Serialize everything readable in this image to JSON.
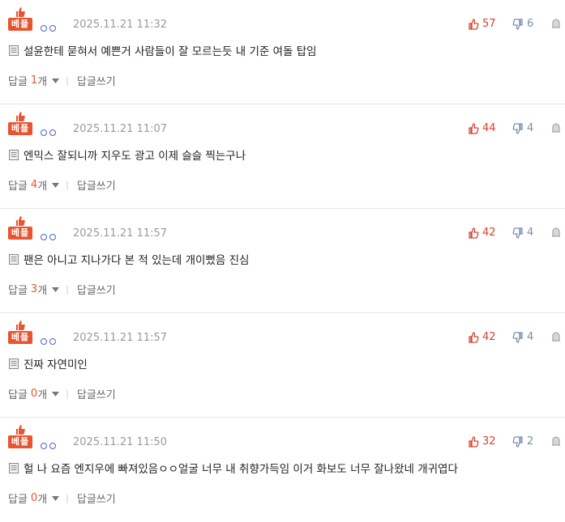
{
  "best_label": "베플",
  "ui": {
    "reply_label": "답글",
    "reply_unit": "개",
    "write_reply": "답글쓰기",
    "separator": "|"
  },
  "comments": [
    {
      "date": "2025.11.21 11:32",
      "recommend": "57",
      "oppose": "6",
      "text": "설윤한테 묻혀서 예쁜거 사람들이 잘 모르는듯 내 기준 여돌 탑임",
      "reply_count": "1"
    },
    {
      "date": "2025.11.21 11:07",
      "recommend": "44",
      "oppose": "4",
      "text": "엔믹스 잘되니까 지우도 광고 이제 슬슬 찍는구나",
      "reply_count": "4"
    },
    {
      "date": "2025.11.21 11:57",
      "recommend": "42",
      "oppose": "4",
      "text": "팬은 아니고 지나가다 본 적 있는데 개이뻤음 진심",
      "reply_count": "3"
    },
    {
      "date": "2025.11.21 11:57",
      "recommend": "42",
      "oppose": "4",
      "text": "진짜 자연미인",
      "reply_count": "0"
    },
    {
      "date": "2025.11.21 11:50",
      "recommend": "32",
      "oppose": "2",
      "text": "헐 나 요즘 엔지우에 빠져있음ㅇㅇ얼굴 너무 내 취향가득임 이거 화보도 너무 잘나왔네 개귀엽다",
      "reply_count": "0"
    }
  ],
  "colors": {
    "accent": "#e8542f",
    "recommend": "#d9412e",
    "oppose": "#7a8faa",
    "nick_circle": "#4a63c9"
  },
  "icons": {
    "best": "thumbs-up-icon",
    "nick": "nickname-circles-icon",
    "recommend": "thumbs-up-icon",
    "oppose": "thumbs-down-icon",
    "report": "report-icon",
    "content": "document-icon",
    "toggle": "chevron-down-icon"
  }
}
